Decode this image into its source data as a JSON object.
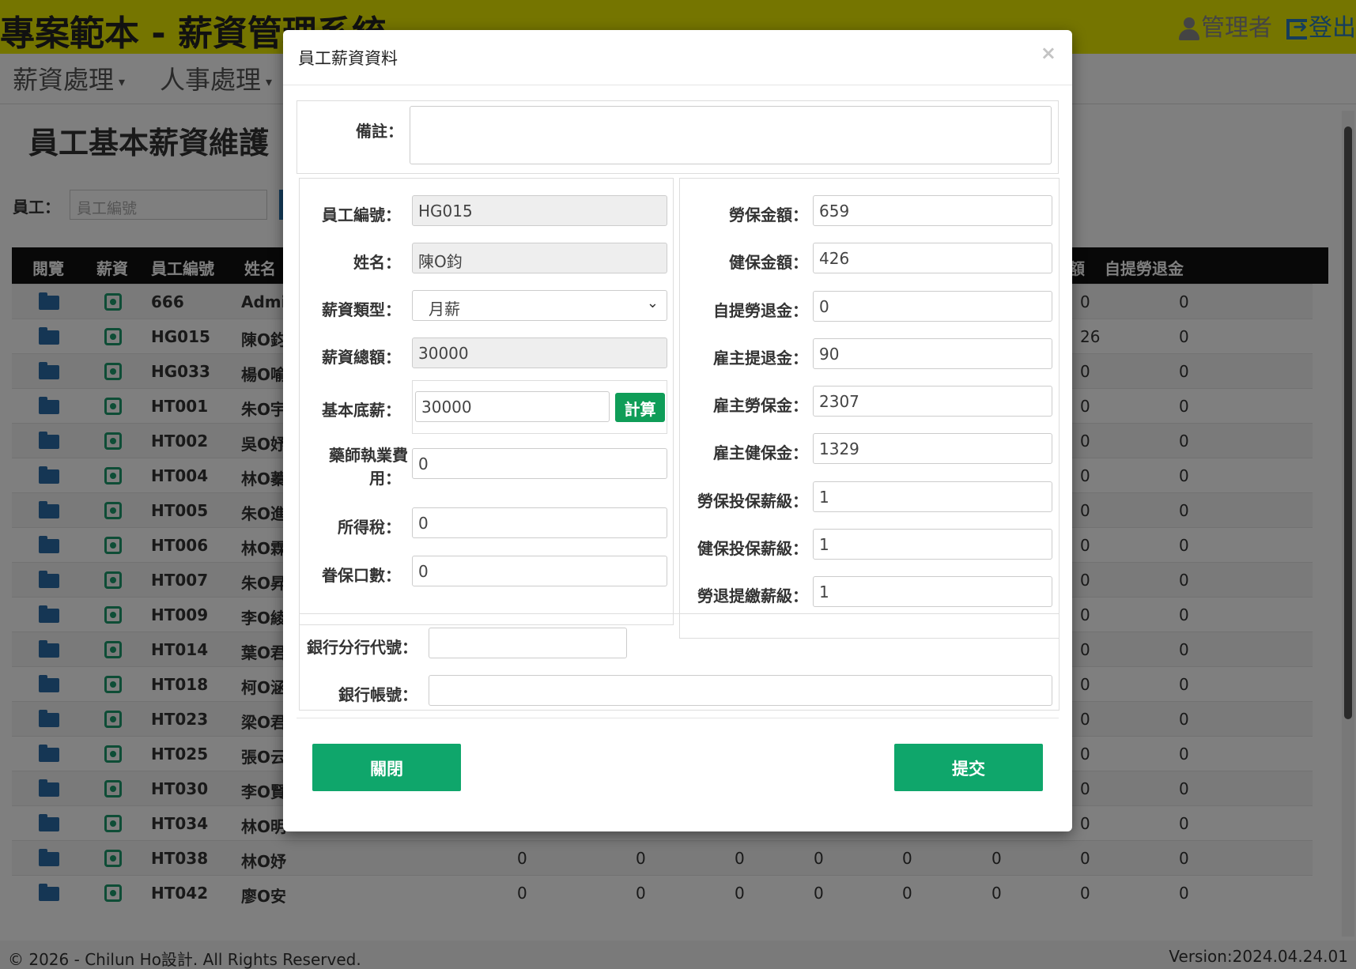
{
  "app": {
    "title": "專案範本 - 薪資管理系統",
    "user_label": "管理者",
    "logout_label": "登出"
  },
  "nav": [
    {
      "label": "薪資處理"
    },
    {
      "label": "人事處理"
    }
  ],
  "page": {
    "title": "員工基本薪資維護",
    "filter_label": "員工：",
    "filter_placeholder": "員工編號"
  },
  "grid": {
    "headers": {
      "view": "閱覽",
      "salary": "薪資",
      "emp_id": "員工編號",
      "name": "姓名",
      "hidden_partial": "額",
      "self_pension": "自提勞退金"
    },
    "rows": [
      {
        "id": "666",
        "name": "Admi",
        "c1": "",
        "c2": "",
        "c3": "",
        "c4": "",
        "c5": "",
        "c6": "",
        "c7": "0",
        "c8": "0"
      },
      {
        "id": "HG015",
        "name": "陳O鈞",
        "c1": "",
        "c2": "",
        "c3": "",
        "c4": "",
        "c5": "",
        "c6": "",
        "c7": "26",
        "c8": "0"
      },
      {
        "id": "HG033",
        "name": "楊O喻",
        "c1": "",
        "c2": "",
        "c3": "",
        "c4": "",
        "c5": "",
        "c6": "",
        "c7": "0",
        "c8": "0"
      },
      {
        "id": "HT001",
        "name": "朱O宇",
        "c1": "",
        "c2": "",
        "c3": "",
        "c4": "",
        "c5": "",
        "c6": "",
        "c7": "0",
        "c8": "0"
      },
      {
        "id": "HT002",
        "name": "吳O妤",
        "c1": "",
        "c2": "",
        "c3": "",
        "c4": "",
        "c5": "",
        "c6": "",
        "c7": "0",
        "c8": "0"
      },
      {
        "id": "HT004",
        "name": "林O蓁",
        "c1": "",
        "c2": "",
        "c3": "",
        "c4": "",
        "c5": "",
        "c6": "",
        "c7": "0",
        "c8": "0"
      },
      {
        "id": "HT005",
        "name": "朱O進",
        "c1": "",
        "c2": "",
        "c3": "",
        "c4": "",
        "c5": "",
        "c6": "",
        "c7": "0",
        "c8": "0"
      },
      {
        "id": "HT006",
        "name": "林O霖",
        "c1": "",
        "c2": "",
        "c3": "",
        "c4": "",
        "c5": "",
        "c6": "",
        "c7": "0",
        "c8": "0"
      },
      {
        "id": "HT007",
        "name": "朱O昇",
        "c1": "",
        "c2": "",
        "c3": "",
        "c4": "",
        "c5": "",
        "c6": "",
        "c7": "0",
        "c8": "0"
      },
      {
        "id": "HT009",
        "name": "李O綾",
        "c1": "",
        "c2": "",
        "c3": "",
        "c4": "",
        "c5": "",
        "c6": "",
        "c7": "0",
        "c8": "0"
      },
      {
        "id": "HT014",
        "name": "葉O君",
        "c1": "",
        "c2": "",
        "c3": "",
        "c4": "",
        "c5": "",
        "c6": "",
        "c7": "0",
        "c8": "0"
      },
      {
        "id": "HT018",
        "name": "柯O涵",
        "c1": "",
        "c2": "",
        "c3": "",
        "c4": "",
        "c5": "",
        "c6": "",
        "c7": "0",
        "c8": "0"
      },
      {
        "id": "HT023",
        "name": "梁O君",
        "c1": "",
        "c2": "",
        "c3": "",
        "c4": "",
        "c5": "",
        "c6": "",
        "c7": "0",
        "c8": "0"
      },
      {
        "id": "HT025",
        "name": "張O云",
        "c1": "",
        "c2": "",
        "c3": "",
        "c4": "",
        "c5": "",
        "c6": "",
        "c7": "0",
        "c8": "0"
      },
      {
        "id": "HT030",
        "name": "李O賢",
        "c1": "",
        "c2": "",
        "c3": "",
        "c4": "",
        "c5": "",
        "c6": "",
        "c7": "0",
        "c8": "0"
      },
      {
        "id": "HT034",
        "name": "林O明",
        "c1": "",
        "c2": "",
        "c3": "",
        "c4": "",
        "c5": "",
        "c6": "",
        "c7": "0",
        "c8": "0"
      },
      {
        "id": "HT038",
        "name": "林O妤",
        "c1": "0",
        "c2": "0",
        "c3": "0",
        "c4": "0",
        "c5": "0",
        "c6": "0",
        "c7": "0",
        "c8": "0"
      },
      {
        "id": "HT042",
        "name": "廖O安",
        "c1": "0",
        "c2": "0",
        "c3": "0",
        "c4": "0",
        "c5": "0",
        "c6": "0",
        "c7": "0",
        "c8": "0"
      }
    ]
  },
  "footer": {
    "copyright": "© 2026 - Chilun Ho設計. All Rights Reserved.",
    "version": "Version:2024.04.24.01"
  },
  "modal": {
    "title": "員工薪資資料",
    "close_symbol": "×",
    "remark_label": "備註：",
    "remark_value": "",
    "left": {
      "emp_id": {
        "label": "員工編號：",
        "value": "HG015"
      },
      "name": {
        "label": "姓名：",
        "value": "陳O鈞"
      },
      "salary_type": {
        "label": "薪資類型：",
        "value": "月薪"
      },
      "salary_total": {
        "label": "薪資總額：",
        "value": "30000"
      },
      "base_salary": {
        "label": "基本底薪：",
        "value": "30000",
        "button": "計算"
      },
      "pharmacist_fee": {
        "label_line1": "藥師執業費",
        "label_line2": "用：",
        "value": "0"
      },
      "income_tax": {
        "label": "所得稅：",
        "value": "0"
      },
      "dependents": {
        "label": "眷保口數：",
        "value": "0"
      }
    },
    "right": {
      "labor_ins": {
        "label": "勞保金額：",
        "value": "659"
      },
      "health_ins": {
        "label": "健保金額：",
        "value": "426"
      },
      "self_pension": {
        "label": "自提勞退金：",
        "value": "0"
      },
      "employer_pension": {
        "label": "雇主提退金：",
        "value": "90"
      },
      "employer_labor_ins": {
        "label": "雇主勞保金：",
        "value": "2307"
      },
      "employer_health_ins": {
        "label": "雇主健保金：",
        "value": "1329"
      },
      "labor_ins_grade": {
        "label": "勞保投保薪級：",
        "value": "1"
      },
      "health_ins_grade": {
        "label": "健保投保薪級：",
        "value": "1"
      },
      "pension_grade": {
        "label": "勞退提繳薪級：",
        "value": "1"
      }
    },
    "bank": {
      "branch_code": {
        "label": "銀行分行代號：",
        "value": ""
      },
      "account": {
        "label": "銀行帳號：",
        "value": ""
      }
    },
    "close_button": "關閉",
    "submit_button": "提交"
  }
}
